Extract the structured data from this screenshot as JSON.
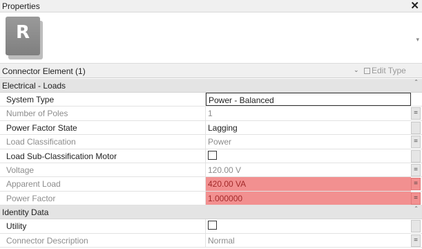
{
  "window": {
    "title": "Properties",
    "close_glyph": "✕"
  },
  "type_selector": {
    "image_letter": "R",
    "dropdown_glyph": "▾"
  },
  "element_selector": {
    "label": "Connector Element (1)",
    "chevron": "⌄",
    "edit_type_label": "Edit Type"
  },
  "groups": [
    {
      "title": "Electrical - Loads",
      "collapse_glyph": "⌃",
      "rows": [
        {
          "name": "System Type",
          "value": "Power - Balanced",
          "name_state": "enabled",
          "value_state": "edit",
          "eq": ""
        },
        {
          "name": "Number of Poles",
          "value": "1",
          "name_state": "disabled",
          "value_state": "disabled",
          "eq": "="
        },
        {
          "name": "Power Factor State",
          "value": "Lagging",
          "name_state": "enabled",
          "value_state": "enabled",
          "eq": ""
        },
        {
          "name": "Load Classification",
          "value": "Power",
          "name_state": "disabled",
          "value_state": "disabled",
          "eq": "="
        },
        {
          "name": "Load Sub-Classification Motor",
          "value": "",
          "checkbox": true,
          "name_state": "enabled",
          "value_state": "enabled",
          "eq": ""
        },
        {
          "name": "Voltage",
          "value": "120.00 V",
          "name_state": "disabled",
          "value_state": "disabled",
          "eq": "="
        },
        {
          "name": "Apparent Load",
          "value": "420.00 VA",
          "name_state": "disabled",
          "value_state": "highlight",
          "eq": "="
        },
        {
          "name": "Power Factor",
          "value": "1.000000",
          "name_state": "disabled",
          "value_state": "highlight",
          "eq": "="
        }
      ]
    },
    {
      "title": "Identity Data",
      "collapse_glyph": "⌃",
      "rows": [
        {
          "name": "Utility",
          "value": "",
          "checkbox": true,
          "name_state": "enabled",
          "value_state": "enabled",
          "eq": ""
        },
        {
          "name": "Connector Description",
          "value": "Normal",
          "name_state": "disabled",
          "value_state": "disabled",
          "eq": "="
        }
      ]
    }
  ],
  "colors": {
    "highlight": "#f29090",
    "highlight_text": "#a32a2a",
    "group_header": "#e4e4e4",
    "disabled_text": "#8c8c8c"
  }
}
